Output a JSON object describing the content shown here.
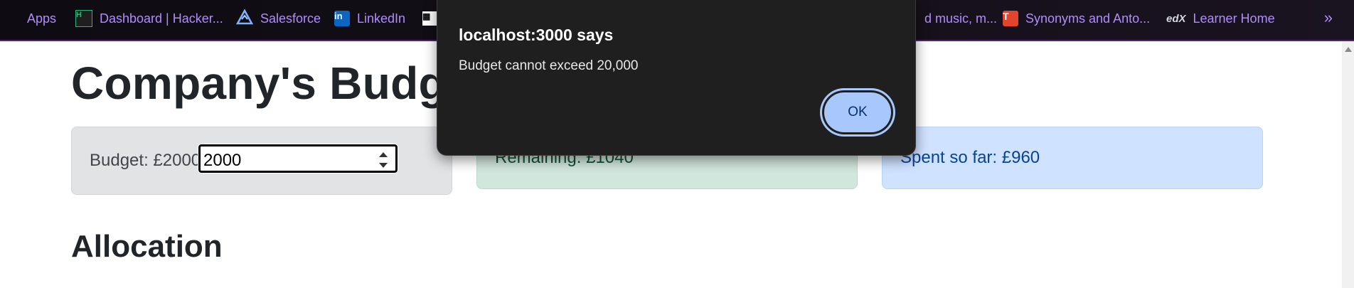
{
  "bookmarks": [
    {
      "label": "Apps",
      "icon": "apps-grid-icon"
    },
    {
      "label": "Dashboard | Hacker...",
      "icon": "hackerrank-icon"
    },
    {
      "label": "Salesforce",
      "icon": "salesforce-icon"
    },
    {
      "label": "LinkedIn",
      "icon": "linkedin-icon"
    },
    {
      "label": "d music, m...",
      "icon": "site-icon"
    },
    {
      "label": "Synonyms and Anto...",
      "icon": "thesaurus-icon"
    },
    {
      "label": "Learner Home",
      "icon": "edx-icon"
    }
  ],
  "bookmark_icon_text": {
    "hackerrank": "H",
    "linkedin": "in",
    "thesaurus": "T",
    "edx": "edX"
  },
  "more_glyph": "»",
  "page": {
    "title": "Company's Budget",
    "budget_label": "Budget: £2000",
    "budget_input_value": "2000",
    "remaining_label": "Remaining: £1040",
    "spent_label": "Spent so far: £960",
    "allocation_heading": "Allocation"
  },
  "dialog": {
    "origin": "localhost:3000 says",
    "message": "Budget cannot exceed 20,000",
    "ok_label": "OK"
  },
  "colors": {
    "remaining_bg": "#d1e7dd",
    "spent_bg": "#cfe2ff",
    "budget_bg": "#e2e3e5",
    "ok_button": "#a8c7fa"
  }
}
